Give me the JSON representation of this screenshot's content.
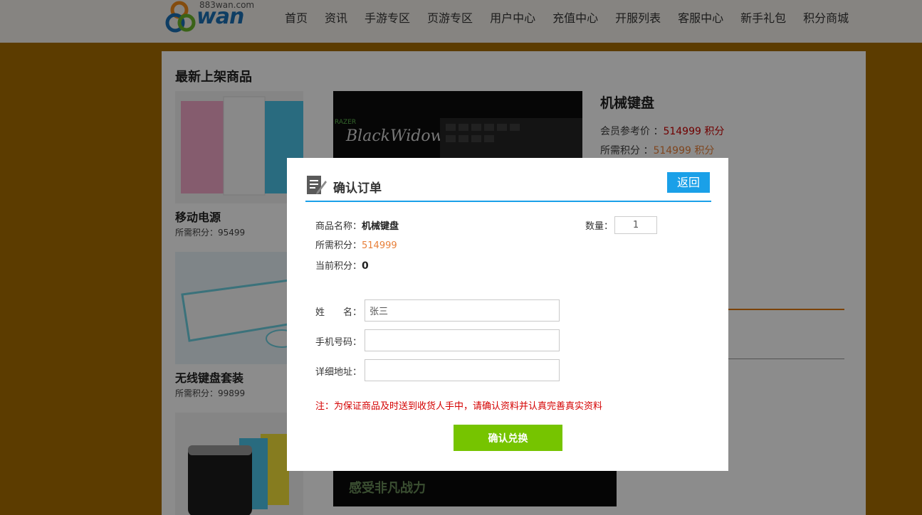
{
  "header": {
    "logo_url_text": "883wan.com",
    "logo_text": "wan",
    "nav": [
      "首页",
      "资讯",
      "手游专区",
      "页游专区",
      "用户中心",
      "充值中心",
      "开服列表",
      "客服中心",
      "新手礼包",
      "积分商城"
    ]
  },
  "main": {
    "section_title": "最新上架商品",
    "products": [
      {
        "name": "移动电源",
        "points_label": "所需积分：95499"
      },
      {
        "name": "无线键盘套装",
        "points_label": "所需积分：99899"
      }
    ],
    "banner_bottom_text": "感受非凡战力",
    "detail": {
      "title": "机械键盘",
      "member_price_label": "会员参考价 ：",
      "member_price_value": "514999 积分",
      "required_label": "所需积分 ：",
      "required_value": "514999 积分"
    }
  },
  "modal": {
    "title": "确认订单",
    "back_label": "返回",
    "product_name_label": "商品名称：",
    "product_name_value": "机械键盘",
    "required_label": "所需积分：",
    "required_value": "514999",
    "current_label": "当前积分：",
    "current_value": "0",
    "quantity_label": "数量：",
    "quantity_value": "1",
    "name_label": "姓　　名：",
    "name_value": "张三",
    "phone_label": "手机号码：",
    "phone_value": "",
    "address_label": "详细地址：",
    "address_value": "",
    "note": "注：为保证商品及时送到收货人手中，请确认资料并认真完善真实资料",
    "submit_label": "确认兑换"
  },
  "colors": {
    "accent_blue": "#1aa0e8",
    "confirm_green": "#76c400",
    "note_red": "#d40000",
    "points_orange": "#e8803a",
    "page_brown": "#a86d00"
  }
}
